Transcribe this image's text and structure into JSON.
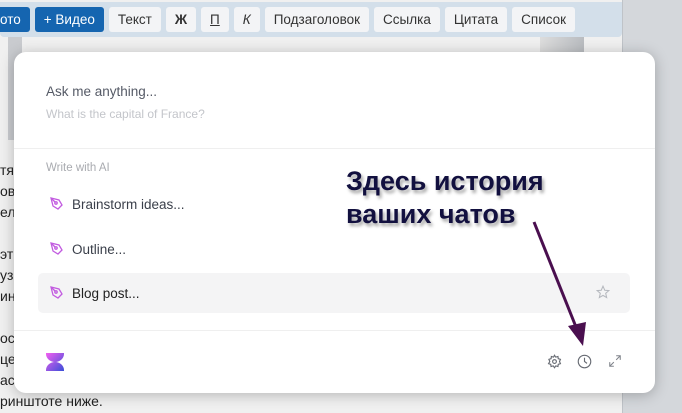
{
  "toolbar": {
    "buttons": [
      "ото",
      "+ Видео",
      "Текст",
      "Ж",
      "П",
      "К",
      "Подзаголовок",
      "Ссылка",
      "Цитата",
      "Список"
    ]
  },
  "background_text": [
    "тя",
    "ов",
    "ела",
    "",
    "эт",
    "уз",
    "ин",
    "",
    "ос",
    "це",
    "ас",
    "ринштоте ниже."
  ],
  "popup": {
    "ask_label": "Ask me anything...",
    "ask_placeholder": "What is the capital of France?",
    "section_label": "Write with AI",
    "items": [
      {
        "label": "Brainstorm ideas..."
      },
      {
        "label": "Outline..."
      },
      {
        "label": "Blog post..."
      }
    ]
  },
  "annotation": {
    "line1": "Здесь история",
    "line2": "ваших чатов"
  },
  "colors": {
    "accent": "#1565b0",
    "pen": "#c25be0",
    "annotation": "#4a0f4f"
  }
}
